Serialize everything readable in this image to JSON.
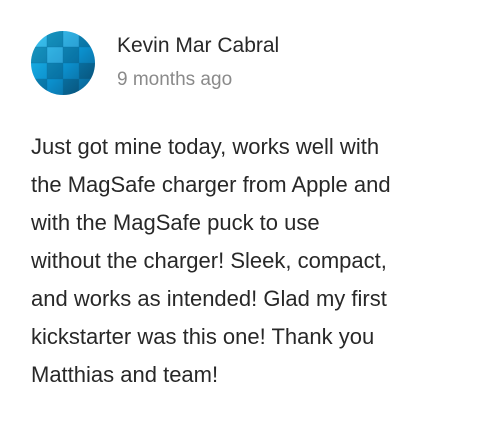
{
  "comment": {
    "author": {
      "name": "Kevin Mar Cabral",
      "avatar_icon": "blue-grid-avatar",
      "avatar_colors": [
        "#1fb6e8",
        "#0a86bf",
        "#0a5f8c"
      ]
    },
    "timestamp": "9 months ago",
    "body_lines": [
      "Just got mine today, works well with",
      "the MagSafe charger from Apple and",
      "with the MagSafe puck to use",
      "without the charger! Sleek, compact,",
      "and works as intended! Glad my first",
      "kickstarter was this one! Thank you",
      "Matthias and team!"
    ]
  }
}
